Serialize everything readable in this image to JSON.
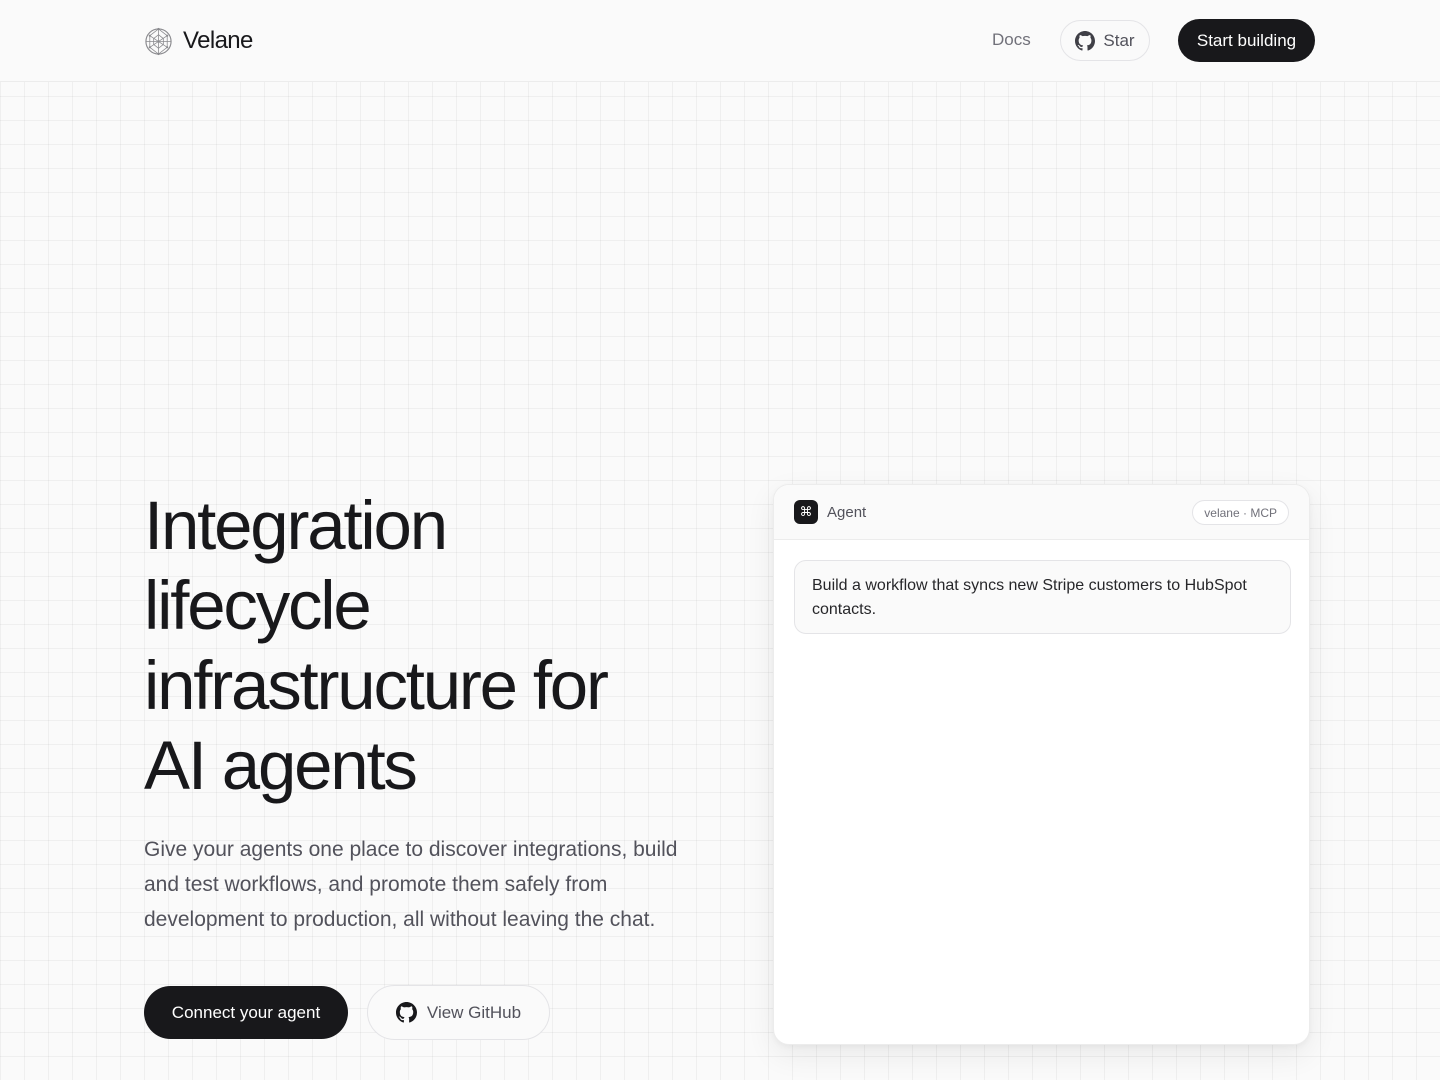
{
  "header": {
    "brand": "Velane",
    "nav_docs": "Docs",
    "star_label": "Star",
    "cta_label": "Start building"
  },
  "hero": {
    "title_lines": [
      "Integration",
      "lifecycle",
      "infrastructure for",
      "AI agents"
    ],
    "subtitle": "Give your agents one place to discover integrations, build and test workflows, and promote them safely from development to production, all without leaving the chat.",
    "primary_cta": "Connect your agent",
    "secondary_cta": "View GitHub"
  },
  "agent_panel": {
    "icon_glyph": "⌘",
    "label": "Agent",
    "badge": "velane · MCP",
    "message": "Build a workflow that syncs new Stripe customers to HubSpot contacts."
  },
  "colors": {
    "primary": "#18181b",
    "muted_text": "#52525b",
    "background": "#fafafa"
  },
  "icons": [
    "velane-logo-icon",
    "github-icon",
    "command-icon"
  ]
}
